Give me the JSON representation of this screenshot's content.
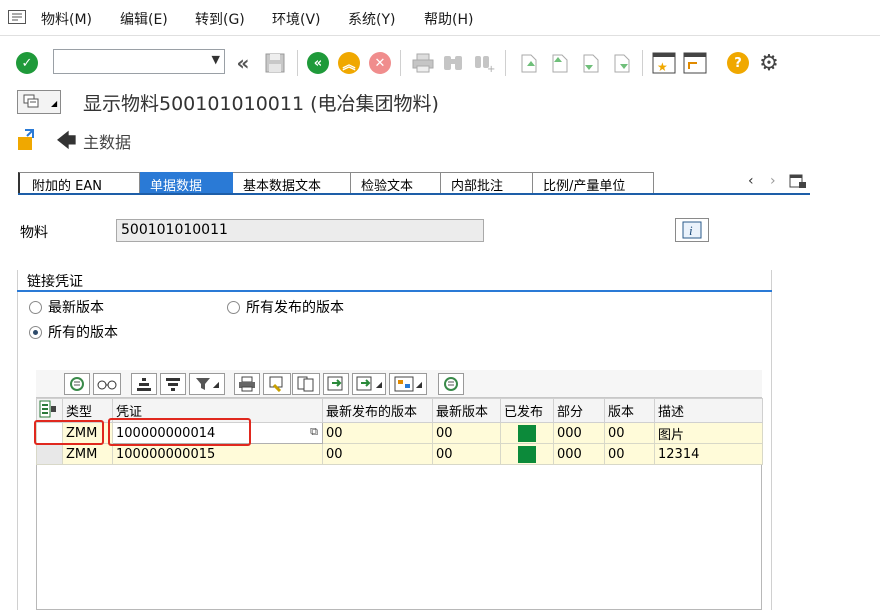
{
  "menu": {
    "items": [
      "物料(M)",
      "编辑(E)",
      "转到(G)",
      "环境(V)",
      "系统(Y)",
      "帮助(H)"
    ]
  },
  "toolbar": {
    "command_value": "",
    "icons": [
      "enter-icon",
      "command-field",
      "back-icon",
      "save-icon",
      "back-circle-icon",
      "exit-icon",
      "cancel-icon",
      "print-icon",
      "find-icon",
      "find-next-icon",
      "first-page-icon",
      "previous-page-icon",
      "next-page-icon",
      "last-page-icon",
      "create-session-icon",
      "shortcut-icon",
      "help-icon",
      "customize-icon"
    ]
  },
  "header": {
    "title": "显示物料500101010011 (电冶集团物料)"
  },
  "app_toolbar": {
    "main_data_label": "主数据"
  },
  "tabs": [
    {
      "label": "附加的 EAN",
      "active": false
    },
    {
      "label": "单据数据",
      "active": true
    },
    {
      "label": "基本数据文本",
      "active": false
    },
    {
      "label": "检验文本",
      "active": false
    },
    {
      "label": "内部批注",
      "active": false
    },
    {
      "label": "比例/产量单位",
      "active": false
    }
  ],
  "material": {
    "label": "物料",
    "value": "500101010011"
  },
  "link_docs": {
    "title": "链接凭证",
    "options": [
      {
        "label": "最新版本",
        "checked": false
      },
      {
        "label": "所有发布的版本",
        "checked": false
      },
      {
        "label": "所有的版本",
        "checked": true
      }
    ]
  },
  "grid": {
    "columns": [
      "类型",
      "凭证",
      "最新发布的版本",
      "最新版本",
      "已发布",
      "部分",
      "版本",
      "描述"
    ],
    "rows": [
      {
        "type": "ZMM",
        "document": "100000000014",
        "latest_released": "00",
        "latest_version": "00",
        "released_color": "#0c8a3a",
        "part": "000",
        "version": "00",
        "description": "图片"
      },
      {
        "type": "ZMM",
        "document": "100000000015",
        "latest_released": "00",
        "latest_version": "00",
        "released_color": "#0c8a3a",
        "part": "000",
        "version": "00",
        "description": "12314"
      }
    ]
  },
  "colors": {
    "active_tab": "#2a7ad6",
    "highlight": "#e0281e",
    "row_background": "#fffbd9"
  }
}
